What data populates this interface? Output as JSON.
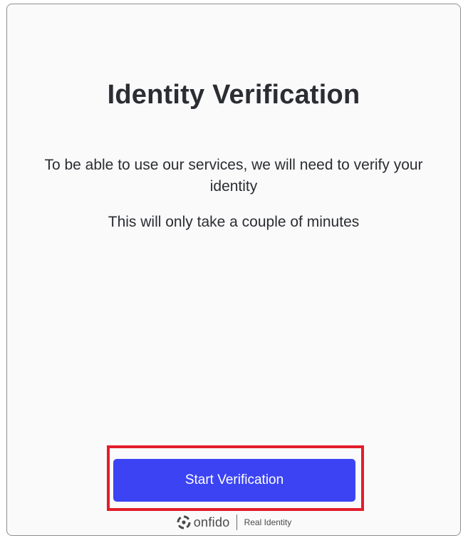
{
  "page": {
    "title": "Identity Verification",
    "paragraph_1": "To be able to use our services, we will need to verify your identity",
    "paragraph_2": "This will only take a couple of minutes"
  },
  "actions": {
    "start_label": "Start Verification"
  },
  "footer": {
    "brand": "onfido",
    "tagline": "Real Identity",
    "logo_icon": "onfido-logo-icon"
  },
  "colors": {
    "button": "#3b43f3",
    "highlight": "#e31d2b",
    "text": "#2b2d33"
  }
}
